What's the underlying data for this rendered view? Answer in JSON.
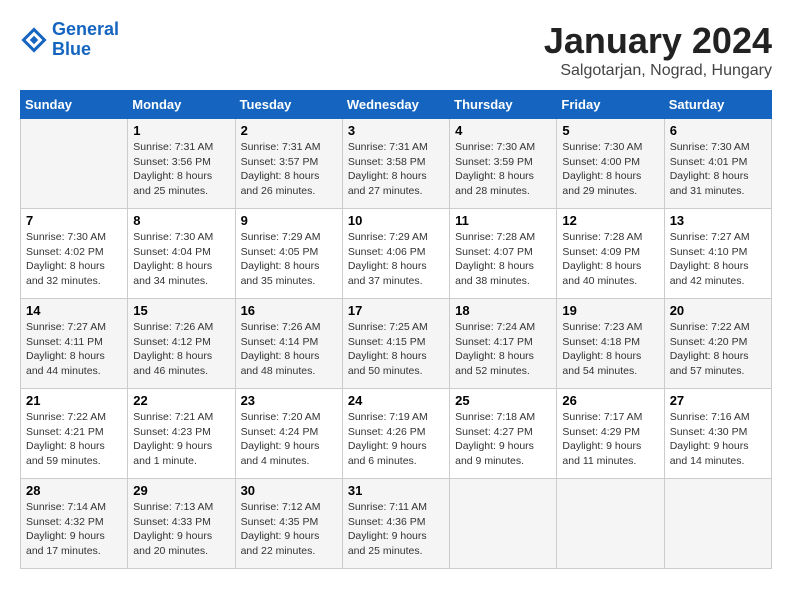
{
  "header": {
    "logo_line1": "General",
    "logo_line2": "Blue",
    "month_title": "January 2024",
    "subtitle": "Salgotarjan, Nograd, Hungary"
  },
  "days_of_week": [
    "Sunday",
    "Monday",
    "Tuesday",
    "Wednesday",
    "Thursday",
    "Friday",
    "Saturday"
  ],
  "weeks": [
    [
      {
        "day": "",
        "info": ""
      },
      {
        "day": "1",
        "info": "Sunrise: 7:31 AM\nSunset: 3:56 PM\nDaylight: 8 hours\nand 25 minutes."
      },
      {
        "day": "2",
        "info": "Sunrise: 7:31 AM\nSunset: 3:57 PM\nDaylight: 8 hours\nand 26 minutes."
      },
      {
        "day": "3",
        "info": "Sunrise: 7:31 AM\nSunset: 3:58 PM\nDaylight: 8 hours\nand 27 minutes."
      },
      {
        "day": "4",
        "info": "Sunrise: 7:30 AM\nSunset: 3:59 PM\nDaylight: 8 hours\nand 28 minutes."
      },
      {
        "day": "5",
        "info": "Sunrise: 7:30 AM\nSunset: 4:00 PM\nDaylight: 8 hours\nand 29 minutes."
      },
      {
        "day": "6",
        "info": "Sunrise: 7:30 AM\nSunset: 4:01 PM\nDaylight: 8 hours\nand 31 minutes."
      }
    ],
    [
      {
        "day": "7",
        "info": "Sunrise: 7:30 AM\nSunset: 4:02 PM\nDaylight: 8 hours\nand 32 minutes."
      },
      {
        "day": "8",
        "info": "Sunrise: 7:30 AM\nSunset: 4:04 PM\nDaylight: 8 hours\nand 34 minutes."
      },
      {
        "day": "9",
        "info": "Sunrise: 7:29 AM\nSunset: 4:05 PM\nDaylight: 8 hours\nand 35 minutes."
      },
      {
        "day": "10",
        "info": "Sunrise: 7:29 AM\nSunset: 4:06 PM\nDaylight: 8 hours\nand 37 minutes."
      },
      {
        "day": "11",
        "info": "Sunrise: 7:28 AM\nSunset: 4:07 PM\nDaylight: 8 hours\nand 38 minutes."
      },
      {
        "day": "12",
        "info": "Sunrise: 7:28 AM\nSunset: 4:09 PM\nDaylight: 8 hours\nand 40 minutes."
      },
      {
        "day": "13",
        "info": "Sunrise: 7:27 AM\nSunset: 4:10 PM\nDaylight: 8 hours\nand 42 minutes."
      }
    ],
    [
      {
        "day": "14",
        "info": "Sunrise: 7:27 AM\nSunset: 4:11 PM\nDaylight: 8 hours\nand 44 minutes."
      },
      {
        "day": "15",
        "info": "Sunrise: 7:26 AM\nSunset: 4:12 PM\nDaylight: 8 hours\nand 46 minutes."
      },
      {
        "day": "16",
        "info": "Sunrise: 7:26 AM\nSunset: 4:14 PM\nDaylight: 8 hours\nand 48 minutes."
      },
      {
        "day": "17",
        "info": "Sunrise: 7:25 AM\nSunset: 4:15 PM\nDaylight: 8 hours\nand 50 minutes."
      },
      {
        "day": "18",
        "info": "Sunrise: 7:24 AM\nSunset: 4:17 PM\nDaylight: 8 hours\nand 52 minutes."
      },
      {
        "day": "19",
        "info": "Sunrise: 7:23 AM\nSunset: 4:18 PM\nDaylight: 8 hours\nand 54 minutes."
      },
      {
        "day": "20",
        "info": "Sunrise: 7:22 AM\nSunset: 4:20 PM\nDaylight: 8 hours\nand 57 minutes."
      }
    ],
    [
      {
        "day": "21",
        "info": "Sunrise: 7:22 AM\nSunset: 4:21 PM\nDaylight: 8 hours\nand 59 minutes."
      },
      {
        "day": "22",
        "info": "Sunrise: 7:21 AM\nSunset: 4:23 PM\nDaylight: 9 hours\nand 1 minute."
      },
      {
        "day": "23",
        "info": "Sunrise: 7:20 AM\nSunset: 4:24 PM\nDaylight: 9 hours\nand 4 minutes."
      },
      {
        "day": "24",
        "info": "Sunrise: 7:19 AM\nSunset: 4:26 PM\nDaylight: 9 hours\nand 6 minutes."
      },
      {
        "day": "25",
        "info": "Sunrise: 7:18 AM\nSunset: 4:27 PM\nDaylight: 9 hours\nand 9 minutes."
      },
      {
        "day": "26",
        "info": "Sunrise: 7:17 AM\nSunset: 4:29 PM\nDaylight: 9 hours\nand 11 minutes."
      },
      {
        "day": "27",
        "info": "Sunrise: 7:16 AM\nSunset: 4:30 PM\nDaylight: 9 hours\nand 14 minutes."
      }
    ],
    [
      {
        "day": "28",
        "info": "Sunrise: 7:14 AM\nSunset: 4:32 PM\nDaylight: 9 hours\nand 17 minutes."
      },
      {
        "day": "29",
        "info": "Sunrise: 7:13 AM\nSunset: 4:33 PM\nDaylight: 9 hours\nand 20 minutes."
      },
      {
        "day": "30",
        "info": "Sunrise: 7:12 AM\nSunset: 4:35 PM\nDaylight: 9 hours\nand 22 minutes."
      },
      {
        "day": "31",
        "info": "Sunrise: 7:11 AM\nSunset: 4:36 PM\nDaylight: 9 hours\nand 25 minutes."
      },
      {
        "day": "",
        "info": ""
      },
      {
        "day": "",
        "info": ""
      },
      {
        "day": "",
        "info": ""
      }
    ]
  ]
}
